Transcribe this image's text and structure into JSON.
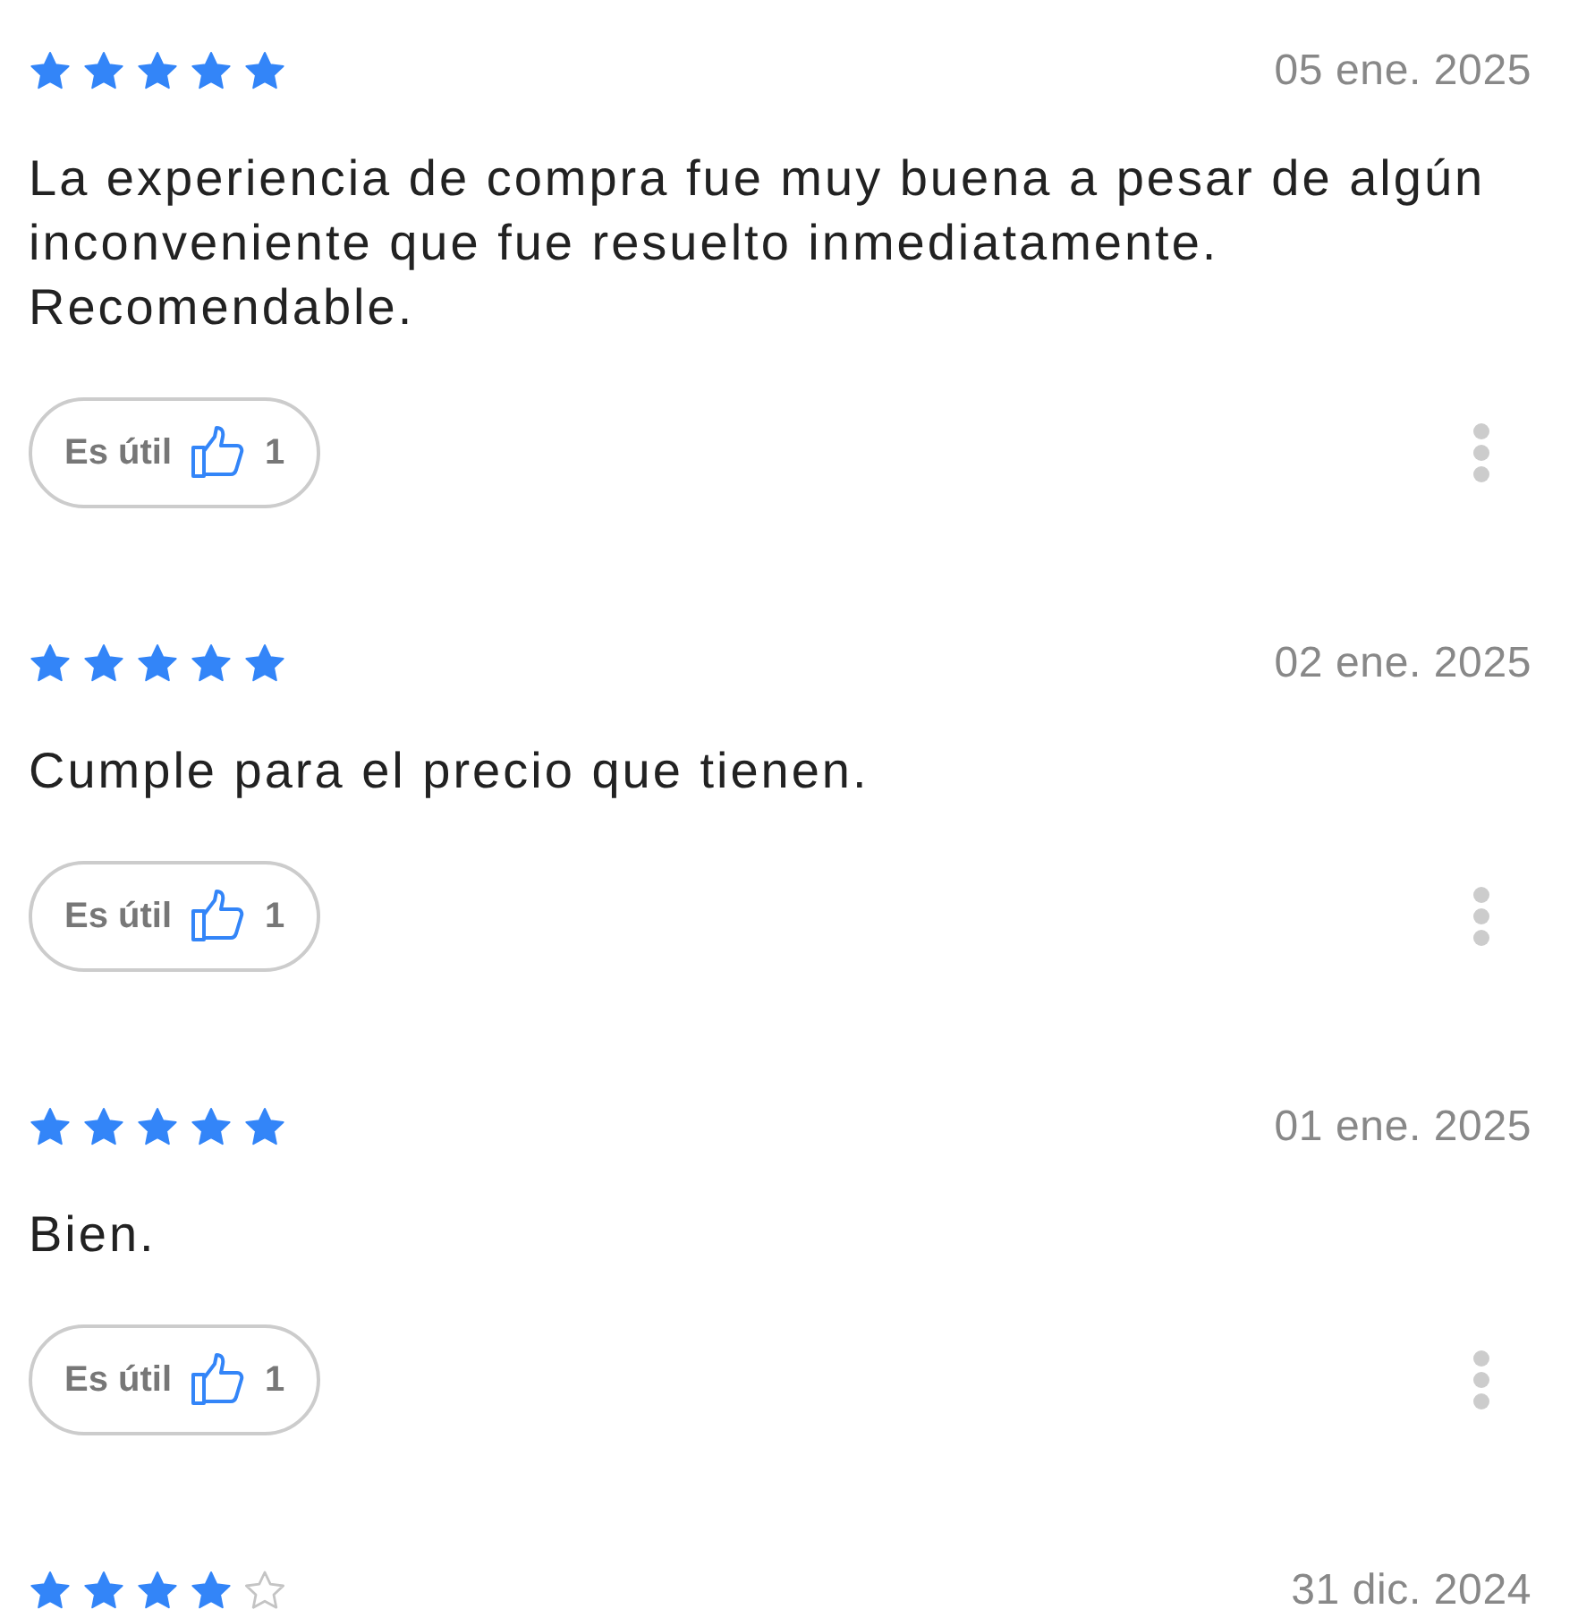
{
  "reviews": [
    {
      "stars": 5,
      "date": "05 ene. 2025",
      "text": "La experiencia de compra fue muy buena a pesar de algún inconveniente que fue resuelto inmediatamente. Recomendable.",
      "helpful_label": "Es útil",
      "helpful_count": "1"
    },
    {
      "stars": 5,
      "date": "02 ene. 2025",
      "text": "Cumple para el precio que tienen.",
      "helpful_label": "Es útil",
      "helpful_count": "1"
    },
    {
      "stars": 5,
      "date": "01 ene. 2025",
      "text": "Bien.",
      "helpful_label": "Es útil",
      "helpful_count": "1"
    },
    {
      "stars": 4,
      "date": "31 dic. 2024"
    }
  ]
}
